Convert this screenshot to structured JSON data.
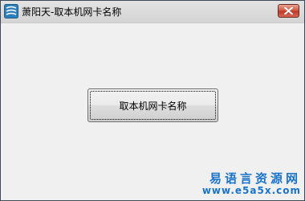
{
  "window": {
    "title": "萧阳天-取本机网卡名称",
    "icon": "app-logo-icon",
    "close_icon": "close-icon"
  },
  "main": {
    "button_label": "取本机网卡名称"
  },
  "watermark": {
    "name": "易语言资源网",
    "url": "www.e5a5x.com"
  },
  "colors": {
    "accent": "#1a73c9",
    "close_button": "#c0392b"
  }
}
